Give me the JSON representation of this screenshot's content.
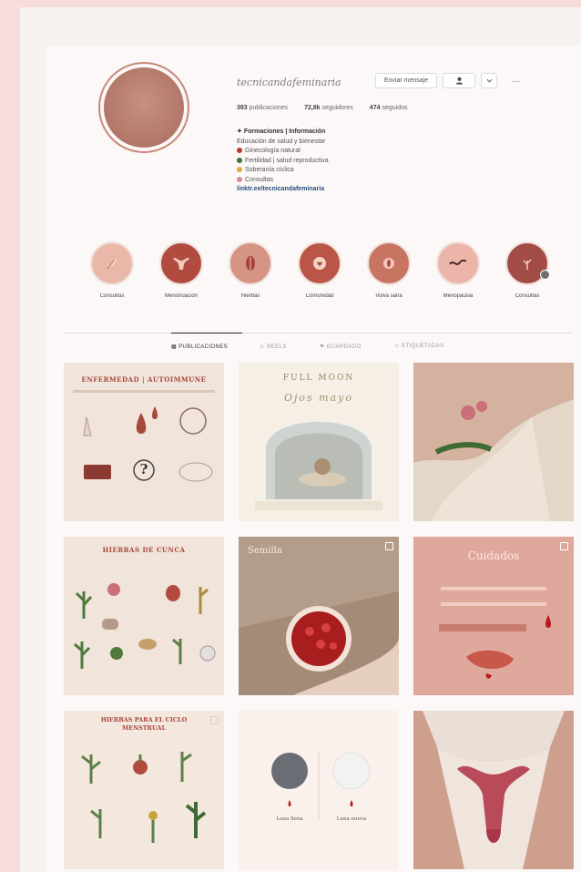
{
  "colors": {
    "page_bg": "#f8dcdc",
    "accent": "#c9887a",
    "avatar": "#b27668",
    "link": "#2a4f7a"
  },
  "profile": {
    "avatar_text": "",
    "username": "tecnicandafeminaria",
    "buttons": {
      "message": "Enviar mensaje",
      "follow": "",
      "dropdown": "",
      "more": "···"
    },
    "stats": {
      "posts": "393",
      "posts_label": "publicaciones",
      "followers": "72,8k",
      "followers_label": "seguidores",
      "following": "474",
      "following_label": "seguidos"
    },
    "bio": {
      "name": "Formaciones | Información",
      "tagline": "Educación de salud y bienestar",
      "lines": [
        "Ginecología natural",
        "Fertilidad | salud reproductiva",
        "Soberanía cíclica",
        "Consultas"
      ],
      "line_colors": [
        "#b53a33",
        "#3e6e3a",
        "#d8b23a",
        "#d58c9c"
      ],
      "link": "linktr.ee/tecnicandafeminaria"
    }
  },
  "highlights": [
    {
      "label": "Consultas",
      "icon": "feather-icon",
      "bg": "#e9b8a8"
    },
    {
      "label": "Menstruación",
      "icon": "uterus-icon",
      "bg": "#b24b3f"
    },
    {
      "label": "Hierbas",
      "icon": "leaf-icon",
      "bg": "#d59484"
    },
    {
      "label": "Comunidad",
      "icon": "heart-icon",
      "bg": "#bb5548"
    },
    {
      "label": "Vulva sana",
      "icon": "flower-icon",
      "bg": "#c77462"
    },
    {
      "label": "Menopausia",
      "icon": "wave-icon",
      "bg": "#ecb5aa"
    },
    {
      "label": "Consultas",
      "icon": "plant-icon",
      "bg": "#a24c46"
    }
  ],
  "tabs": [
    {
      "label": "PUBLICACIONES",
      "active": true
    },
    {
      "label": "REELS",
      "active": false
    },
    {
      "label": "GUARDADO",
      "active": false
    },
    {
      "label": "ETIQUETADAS",
      "active": false
    }
  ],
  "posts": [
    {
      "title": "ENFERMEDAD | AUTOIMMUNE",
      "subtitle": "",
      "labels": [
        "?"
      ]
    },
    {
      "title": "FULL MOON",
      "subtitle": "Ojos mayo",
      "labels": []
    },
    {
      "title": "",
      "subtitle": "",
      "labels": []
    },
    {
      "title": "HIERBAS DE CUNCA",
      "subtitle": "",
      "labels": []
    },
    {
      "title": "Semilla",
      "subtitle": "",
      "labels": []
    },
    {
      "title": "Cuidados",
      "subtitle": "",
      "labels": []
    },
    {
      "title": "HIERBAS PARA EL CICLO MENSTRUAL",
      "subtitle": "",
      "labels": []
    },
    {
      "title": "",
      "subtitle": "",
      "labels": [
        "Luna llena",
        "Luna nueva"
      ]
    },
    {
      "title": "",
      "subtitle": "",
      "labels": []
    }
  ]
}
